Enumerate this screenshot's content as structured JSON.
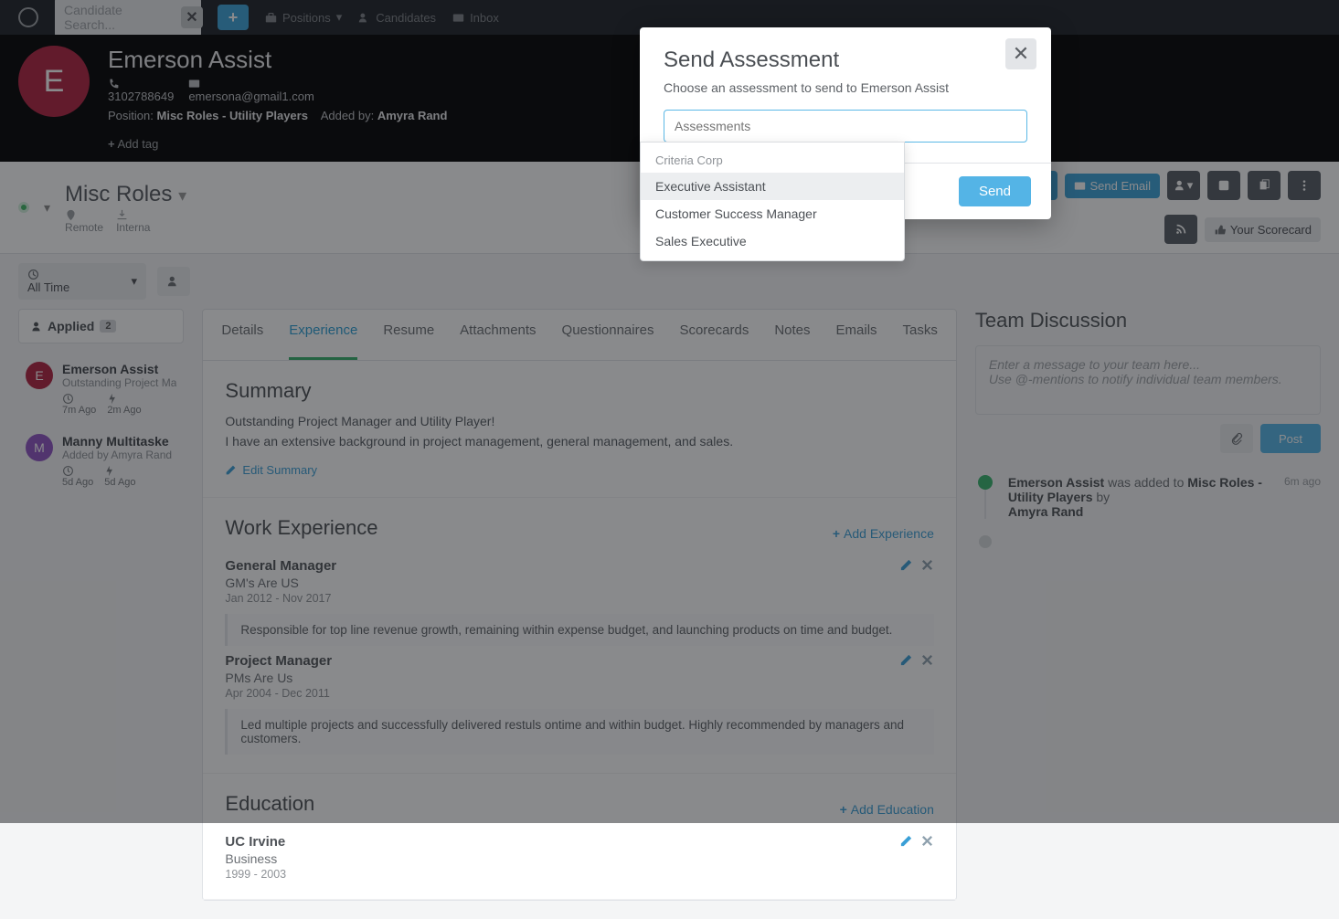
{
  "topnav": {
    "search_placeholder": "Candidate Search...",
    "items": [
      "Positions",
      "Candidates",
      "Inbox"
    ]
  },
  "position_header": {
    "title": "Misc Roles",
    "location": "Remote",
    "type": "Interna",
    "applied_label": "Applied",
    "send_email": "Send Email",
    "scorecard": "Your Scorecard",
    "alltime": "All Time"
  },
  "candidate_header": {
    "initial": "E",
    "name": "Emerson Assist",
    "phone": "3102788649",
    "email": "emersona@gmail1.com",
    "position_label": "Position:",
    "position_value": "Misc Roles - Utility Players",
    "addedby_label": "Added by:",
    "addedby_value": "Amyra Rand",
    "add_tag": "Add tag"
  },
  "left_panel": {
    "header": "Applied",
    "count": "2",
    "candidates": [
      {
        "initial": "E",
        "color": "#b0213f",
        "name": "Emerson Assist",
        "sub": "Outstanding Project Ma",
        "t1": "7m Ago",
        "t2": "2m Ago"
      },
      {
        "initial": "M",
        "color": "#8e52c2",
        "name": "Manny Multitaske",
        "sub": "Added by Amyra Rand",
        "t1": "5d Ago",
        "t2": "5d Ago"
      }
    ]
  },
  "tabs": [
    "Details",
    "Experience",
    "Resume",
    "Attachments",
    "Questionnaires",
    "Scorecards",
    "Notes",
    "Emails",
    "Tasks"
  ],
  "active_tab_index": 1,
  "summary": {
    "heading": "Summary",
    "line1": "Outstanding Project Manager and Utility Player!",
    "line2": "I have an extensive background in project management, general management, and sales.",
    "edit": "Edit Summary"
  },
  "work_experience": {
    "heading": "Work Experience",
    "add": "Add Experience",
    "jobs": [
      {
        "title": "General Manager",
        "company": "GM's Are US",
        "dates": "Jan 2012 - Nov 2017",
        "desc": "Responsible for top line revenue growth, remaining within expense budget, and launching products on time and budget."
      },
      {
        "title": "Project Manager",
        "company": "PMs Are Us",
        "dates": "Apr 2004 - Dec 2011",
        "desc": "Led multiple projects and successfully delivered restuls ontime and within budget. Highly recommended by managers and customers."
      }
    ]
  },
  "education": {
    "heading": "Education",
    "add": "Add Education",
    "schools": [
      {
        "school": "UC Irvine",
        "degree": "Business",
        "dates": "1999 - 2003"
      }
    ]
  },
  "discussion": {
    "heading": "Team Discussion",
    "placeholder_line1": "Enter a message to your team here...",
    "placeholder_line2": "Use @-mentions to notify individual team members.",
    "post": "Post",
    "timeline": {
      "name": "Emerson Assist",
      "mid": " was added to ",
      "target": "Misc Roles - Utility Players",
      "by": " by ",
      "author": "Amyra Rand",
      "time": "6m ago"
    }
  },
  "modal": {
    "title": "Send Assessment",
    "subtitle": "Choose an assessment to send to Emerson Assist",
    "input_placeholder": "Assessments",
    "send": "Send",
    "group": "Criteria Corp",
    "options": [
      "Executive Assistant",
      "Customer Success Manager",
      "Sales Executive"
    ],
    "highlighted_index": 0
  }
}
